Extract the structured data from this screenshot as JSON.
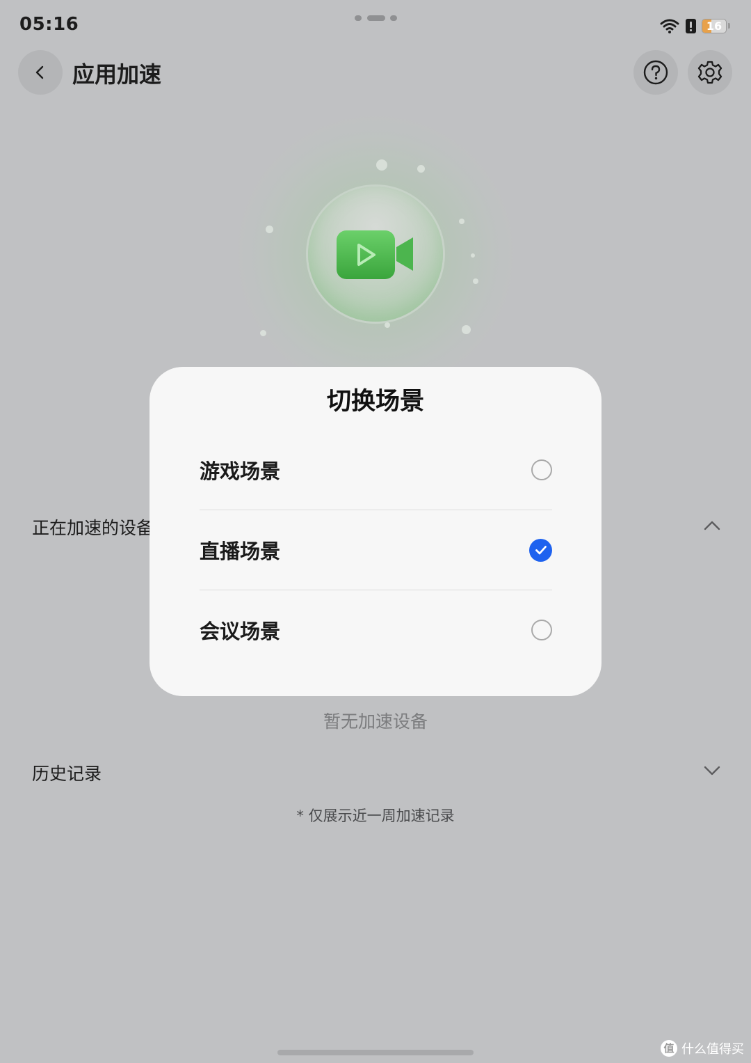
{
  "status_bar": {
    "time": "05:16",
    "battery_level": "16",
    "icons": [
      "wifi-icon",
      "sim-icon",
      "battery-icon"
    ]
  },
  "header": {
    "title": "应用加速",
    "icons": [
      "back-icon",
      "help-icon",
      "settings-icon"
    ]
  },
  "hero": {
    "icon": "video-camera-icon",
    "accent_color": "#4cb54e"
  },
  "sections": {
    "accelerating_devices": "正在加速的设备",
    "empty_devices": "暂无加速设备",
    "history": "历史记录",
    "history_note": "* 仅展示近一周加速记录"
  },
  "dialog": {
    "title": "切换场景",
    "options": [
      {
        "label": "游戏场景",
        "selected": false
      },
      {
        "label": "直播场景",
        "selected": true
      },
      {
        "label": "会议场景",
        "selected": false
      }
    ],
    "selected_color": "#1e62ef"
  },
  "watermark": {
    "logo_text": "值",
    "text": "什么值得买"
  }
}
